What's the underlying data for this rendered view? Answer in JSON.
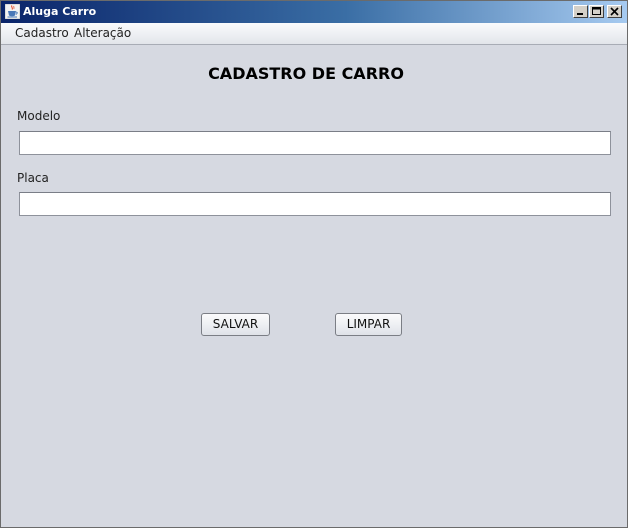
{
  "window": {
    "title": "Aluga Carro"
  },
  "menubar": {
    "items": [
      {
        "label": "Cadastro"
      },
      {
        "label": "Alteração"
      }
    ]
  },
  "form": {
    "title": "CADASTRO DE CARRO",
    "fields": {
      "modelo": {
        "label": "Modelo",
        "value": ""
      },
      "placa": {
        "label": "Placa",
        "value": ""
      }
    },
    "buttons": {
      "salvar": "SALVAR",
      "limpar": "LIMPAR"
    }
  },
  "icons": {
    "app": "java-coffee-cup-icon",
    "minimize": "minimize-icon",
    "maximize": "maximize-icon",
    "close": "close-icon"
  },
  "colors": {
    "titlebar_start": "#0a246a",
    "titlebar_end": "#a6caf0",
    "content_background": "#d6d9e1"
  }
}
